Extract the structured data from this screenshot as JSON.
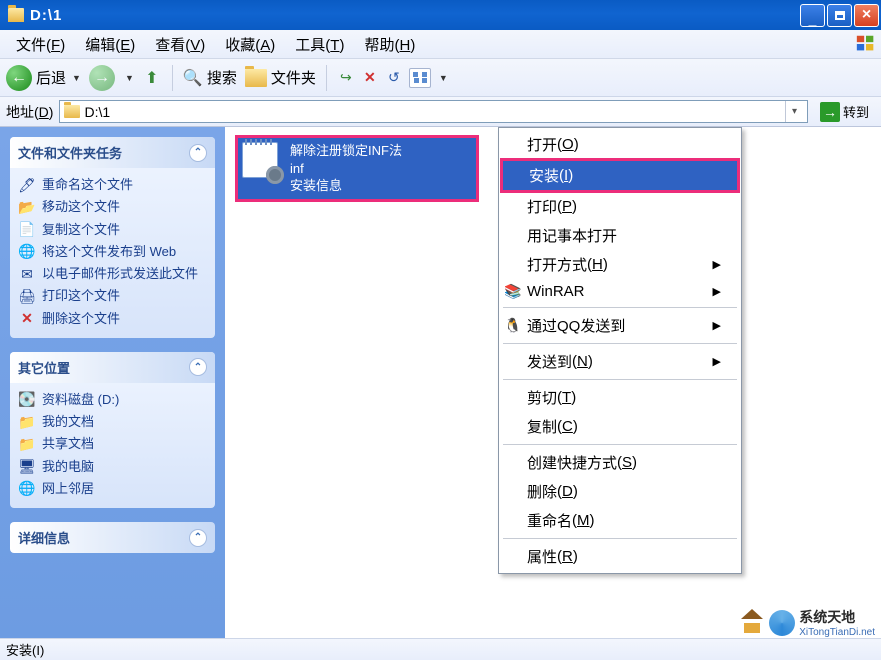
{
  "window": {
    "title": "D:\\1"
  },
  "menu": {
    "file": {
      "label": "文件",
      "key": "F"
    },
    "edit": {
      "label": "编辑",
      "key": "E"
    },
    "view": {
      "label": "查看",
      "key": "V"
    },
    "favorites": {
      "label": "收藏",
      "key": "A"
    },
    "tools": {
      "label": "工具",
      "key": "T"
    },
    "help": {
      "label": "帮助",
      "key": "H"
    }
  },
  "toolbar": {
    "back_label": "后退",
    "search_label": "搜索",
    "folders_label": "文件夹"
  },
  "address": {
    "label_pre": "地址",
    "label_key": "D",
    "path": "D:\\1",
    "go_label": "转到"
  },
  "sidebar": {
    "tasks": {
      "title": "文件和文件夹任务",
      "items": [
        {
          "icon": "rename",
          "label": "重命名这个文件"
        },
        {
          "icon": "move",
          "label": "移动这个文件"
        },
        {
          "icon": "copy",
          "label": "复制这个文件"
        },
        {
          "icon": "publish",
          "label": "将这个文件发布到 Web"
        },
        {
          "icon": "email",
          "label": "以电子邮件形式发送此文件"
        },
        {
          "icon": "print",
          "label": "打印这个文件"
        },
        {
          "icon": "delete",
          "label": "删除这个文件"
        }
      ]
    },
    "places": {
      "title": "其它位置",
      "items": [
        {
          "icon": "drive",
          "label": "资料磁盘 (D:)"
        },
        {
          "icon": "mydocs",
          "label": "我的文档"
        },
        {
          "icon": "shared",
          "label": "共享文档"
        },
        {
          "icon": "mycomputer",
          "label": "我的电脑"
        },
        {
          "icon": "network",
          "label": "网上邻居"
        }
      ]
    },
    "details": {
      "title": "详细信息"
    }
  },
  "file": {
    "name": "解除注册锁定INF法.inf",
    "line1": "解除注册锁定INF法",
    "line2": "inf",
    "line3": "安装信息"
  },
  "context_menu": {
    "open": {
      "label": "打开",
      "key": "O"
    },
    "install": {
      "label": "安装",
      "key": "I"
    },
    "print": {
      "label": "打印",
      "key": "P"
    },
    "notepad": {
      "label": "用记事本打开"
    },
    "open_with": {
      "label": "打开方式",
      "key": "H"
    },
    "winrar": {
      "label": "WinRAR"
    },
    "qq_send": {
      "label": "通过QQ发送到"
    },
    "send_to": {
      "label": "发送到",
      "key": "N"
    },
    "cut": {
      "label": "剪切",
      "key": "T"
    },
    "copy": {
      "label": "复制",
      "key": "C"
    },
    "shortcut": {
      "label": "创建快捷方式",
      "key": "S"
    },
    "delete": {
      "label": "删除",
      "key": "D"
    },
    "rename": {
      "label": "重命名",
      "key": "M"
    },
    "properties": {
      "label": "属性",
      "key": "R"
    }
  },
  "statusbar": {
    "text": "安装(I)"
  },
  "watermark": {
    "line1": "系统天地",
    "line2": "XiTongTianDi.net"
  }
}
